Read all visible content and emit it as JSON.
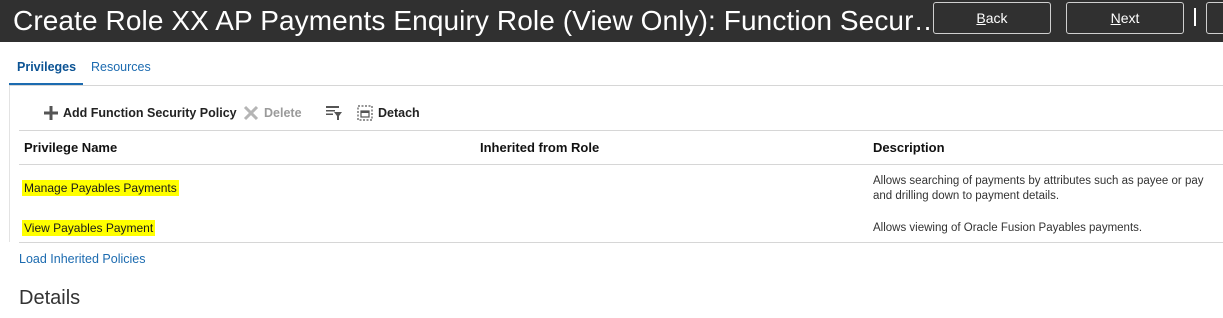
{
  "header": {
    "title": "Create Role XX AP Payments Enquiry Role (View Only): Function Secur…",
    "back_button": {
      "mnemonic": "B",
      "rest": "ack"
    },
    "next_button": {
      "mnemonic": "N",
      "rest": "ext"
    }
  },
  "tabs": [
    {
      "label": "Privileges",
      "selected": true
    },
    {
      "label": "Resources",
      "selected": false
    }
  ],
  "toolbar": {
    "add_label": "Add Function Security Policy",
    "delete_label": "Delete",
    "detach_label": "Detach",
    "icons": [
      "plus-icon",
      "delete-x-icon",
      "query-by-example-icon",
      "detach-icon"
    ]
  },
  "table": {
    "columns": [
      "Privilege Name",
      "Inherited from Role",
      "Description"
    ],
    "rows": [
      {
        "name": "Manage Payables Payments",
        "inherited": "",
        "description_line1": "Allows searching of payments by attributes such as payee or pay",
        "description_line2": "and drilling down to payment details."
      },
      {
        "name": "View Payables Payment",
        "inherited": "",
        "description_line1": "Allows viewing of Oracle Fusion Payables payments."
      }
    ]
  },
  "load_inherited_label": "Load Inherited Policies",
  "details_heading": "Details",
  "colors": {
    "title_bar": "#303030",
    "link": "#1c6bb0",
    "highlight": "#ffff00"
  }
}
